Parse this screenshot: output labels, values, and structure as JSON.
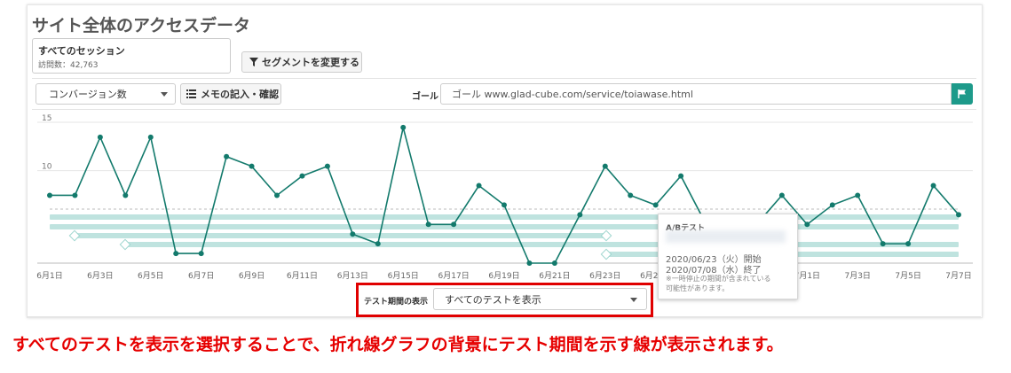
{
  "page": {
    "title": "サイト全体のアクセスデータ"
  },
  "segment": {
    "name": "すべてのセッション",
    "visits": "訪問数：42,763",
    "change_button": "セグメントを変更する"
  },
  "toolbar": {
    "metric_select": "コンバージョン数",
    "memo_button": "メモの記入・確認",
    "goal_label": "ゴール",
    "goal_value": "ゴール www.glad-cube.com/service/toiawase.html"
  },
  "colors": {
    "accent": "#1d9a8a",
    "line": "#137a6c",
    "band": "#bfe3df",
    "highlight": "#e00000"
  },
  "chart_data": {
    "type": "line",
    "y_ticks": [
      "15",
      "10"
    ],
    "ylim": [
      0,
      15
    ],
    "x_labels": [
      "6月1日",
      "6月3日",
      "6月5日",
      "6月7日",
      "6月9日",
      "6月11日",
      "6月13日",
      "6月15日",
      "6月17日",
      "6月19日",
      "6月21日",
      "6月23日",
      "6月25日",
      "6月27日",
      "6月29日",
      "7月1日",
      "7月3日",
      "7月5日",
      "7月7日"
    ],
    "series": [
      {
        "x": [
          "6/1",
          "6/2",
          "6/3",
          "6/4",
          "6/5",
          "6/6",
          "6/7",
          "6/8",
          "6/9",
          "6/10",
          "6/11",
          "6/12",
          "6/13",
          "6/14",
          "6/15",
          "6/16",
          "6/17",
          "6/18",
          "6/19",
          "6/20",
          "6/21",
          "6/22",
          "6/23",
          "6/24",
          "6/25",
          "6/26",
          "6/27",
          "6/28",
          "6/29",
          "6/30",
          "7/1",
          "7/2",
          "7/3",
          "7/4",
          "7/5",
          "7/6",
          "7/7"
        ],
        "values": [
          7,
          7,
          13,
          7,
          13,
          1,
          1,
          11,
          10,
          7,
          9,
          10,
          3,
          2,
          14,
          4,
          4,
          8,
          6,
          0,
          0,
          5,
          10,
          7,
          6,
          9,
          4,
          4,
          4,
          7,
          4,
          6,
          7,
          2,
          2,
          8,
          5
        ]
      }
    ],
    "test_bands": 4
  },
  "tooltip": {
    "title": "A/Bテスト",
    "start": "2020/06/23（火）開始",
    "end": "2020/07/08（水）終了",
    "note_line1": "※一時停止の期間が含まれている",
    "note_line2": "可能性があります。"
  },
  "period": {
    "label": "テスト期間の表示",
    "select_value": "すべてのテストを表示"
  },
  "caption": "すべてのテストを表示を選択することで、折れ線グラフの背景にテスト期間を示す線が表示されます。"
}
